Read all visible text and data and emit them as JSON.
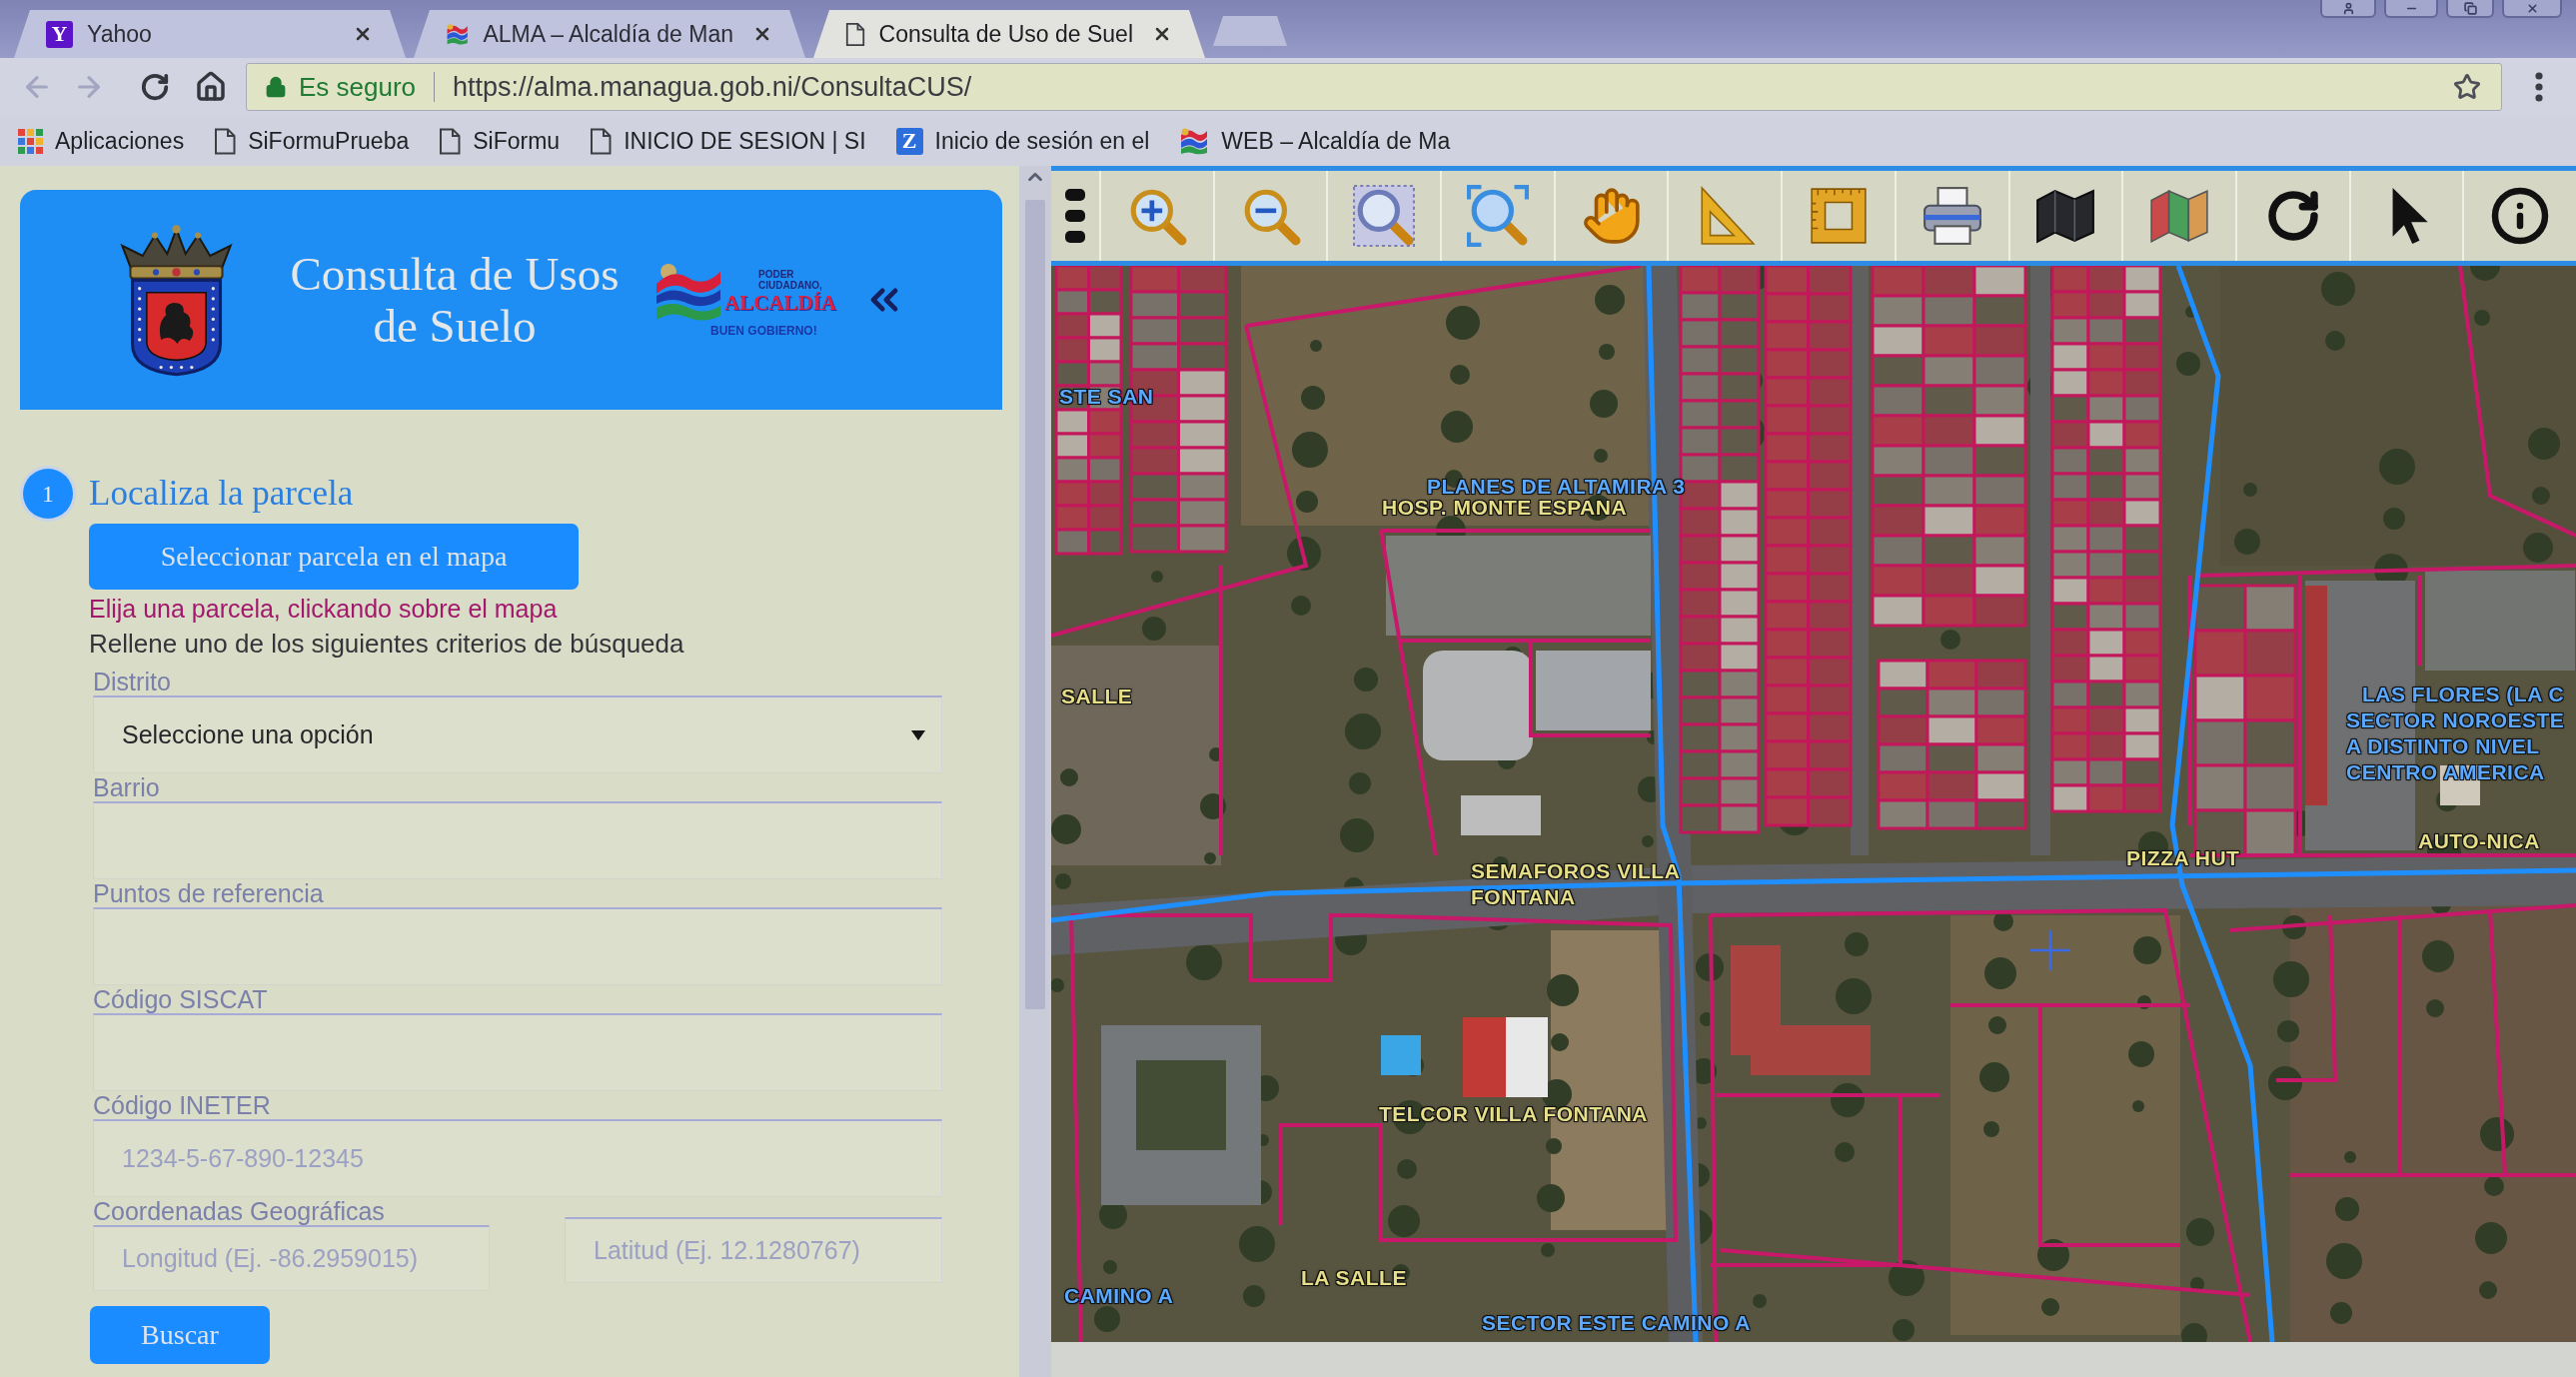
{
  "browser": {
    "tabs": [
      {
        "title": "Yahoo",
        "icon_text": "Y",
        "color": "#5b14c8",
        "selected": false
      },
      {
        "title": "ALMA – Alcaldía de Man",
        "selected": false
      },
      {
        "title": "Consulta de Uso de Suel",
        "selected": true
      }
    ],
    "navigation": {
      "back_disabled": true,
      "forward_disabled": true
    },
    "address_bar": {
      "security_label": "Es seguro",
      "url": "https://alma.managua.gob.ni/ConsultaCUS/"
    },
    "bookmarks": [
      {
        "label": "Aplicaciones"
      },
      {
        "label": "SiFormuPrueba"
      },
      {
        "label": "SiFormu"
      },
      {
        "label": "INICIO DE SESION | SI"
      },
      {
        "label": "Inicio de sesión en el",
        "icon_text": "Z",
        "color": "#2c6fdc"
      },
      {
        "label": "WEB – Alcaldía de Ma"
      }
    ]
  },
  "header": {
    "title_lines": [
      "Consulta de Usos",
      "de Suelo"
    ],
    "logo": {
      "tagline_lines": [
        "PODER",
        "CIUDADANO,"
      ],
      "name": "ALCALDÍA",
      "slogan": "BUEN GOBIERNO!"
    }
  },
  "step": {
    "number": "1",
    "title": "Localiza la parcela",
    "button": "Seleccionar parcela en el mapa",
    "hint": "Elija una parcela, clickando sobre el mapa"
  },
  "search": {
    "instruction": "Rellene uno de los siguientes criterios de búsqueda",
    "fields": [
      {
        "kind": "select",
        "label": "Distrito",
        "value": "Seleccione una opción"
      },
      {
        "kind": "text",
        "label": "Barrio"
      },
      {
        "kind": "text",
        "label": "Puntos de referencia"
      },
      {
        "kind": "text",
        "label": "Código SISCAT"
      },
      {
        "kind": "text",
        "label": "Código INETER",
        "placeholder": "1234-5-67-890-12345"
      },
      {
        "kind": "pair",
        "label": "Coordenadas Geográficas",
        "inputs": [
          {
            "placeholder": "Longitud (Ej. -86.2959015)"
          },
          {
            "placeholder": "Latitud (Ej. 12.1280767)"
          }
        ]
      }
    ],
    "submit": "Buscar"
  },
  "map": {
    "labels": [
      {
        "kind": "sector",
        "lines": [
          "STE SAN"
        ]
      },
      {
        "kind": "sector",
        "lines": [
          "PLANES DE ALTAMIRA 3"
        ]
      },
      {
        "kind": "place",
        "lines": [
          "HOSP. MONTE ESPANA"
        ]
      },
      {
        "kind": "place",
        "lines": [
          "SALLE"
        ]
      },
      {
        "kind": "sector",
        "lines": [
          "LAS FLORES (LA C"
        ]
      },
      {
        "kind": "sector",
        "lines": [
          "SECTOR NOROESTE",
          "A DISTINTO NIVEL",
          "CENTRO AMERICA"
        ]
      },
      {
        "kind": "place",
        "lines": [
          "AUTO-NICA"
        ]
      },
      {
        "kind": "place",
        "lines": [
          "PIZZA HUT"
        ]
      },
      {
        "kind": "place",
        "lines": [
          "SEMAFOROS VILLA",
          "FONTANA"
        ]
      },
      {
        "kind": "place",
        "lines": [
          "TELCOR VILLA FONTANA"
        ]
      },
      {
        "kind": "place",
        "lines": [
          "LA SALLE"
        ]
      },
      {
        "kind": "sector",
        "lines": [
          "CAMINO A"
        ]
      },
      {
        "kind": "sector",
        "lines": [
          "SECTOR ESTE CAMINO A"
        ]
      }
    ]
  }
}
